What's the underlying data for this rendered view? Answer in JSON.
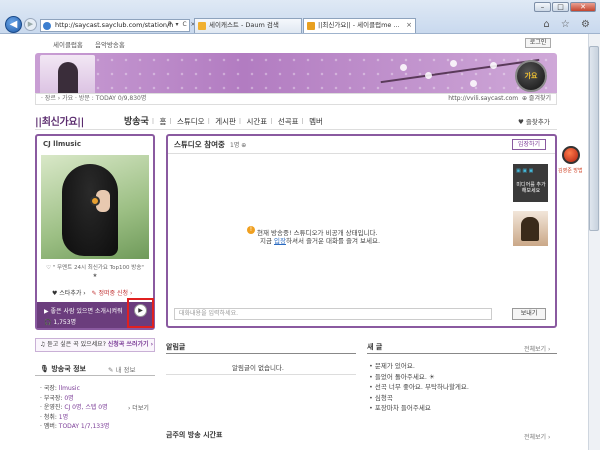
{
  "browser": {
    "address": "http://saycast.sayclub.com/station/h",
    "address_tools": "P ▾ C ×",
    "tabs": [
      {
        "label": "세이캐스트 - Daum 검색"
      },
      {
        "label": "||최신가요|| - 세이클럽me ..."
      }
    ],
    "win_min": "–",
    "win_max": "□",
    "win_close": "✕",
    "back": "◀",
    "forward": "▶",
    "ie_tools": "⌂ ☆ ⚙"
  },
  "site": {
    "top_links": [
      "세이클럽홈",
      "음악방송홈"
    ],
    "login": "로그인",
    "banner_badge": "가요",
    "info_left": "· 장르 › 가요 · 방문 : TODAY 0/9,830명",
    "info_url": "http://vvili.saycast.com",
    "info_fav": "⊕ 즐겨찾기",
    "channel_title": "||최신가요||",
    "nav": [
      "방송국",
      "홈",
      "스튜디오",
      "게시판",
      "시간표",
      "선곡표",
      "멤버"
    ],
    "fav_add": "♥ 즐찾추가"
  },
  "profile": {
    "dj_name": "CJ llmusic",
    "quote": "♡ \" 무멘트 24시 최신가요 Top100 방송\" ★",
    "star_add": "♥ 스타추가 ›",
    "report": "✎ 정떠중 신청 ›",
    "now_playing": "▶ 좋은 사람 있으면 소개시켜줘",
    "listeners": "🎧 1,753명",
    "play_icon": "▶"
  },
  "request": {
    "text": "♫ 듣고 싶은 곡 있으세요? ",
    "link": "신청곡 쓰러가기 ›"
  },
  "station_info": {
    "tab_station": "🎙 방송국 정보",
    "tab_myinfo": "✎ 내 정보",
    "rows": [
      {
        "label": "· 국장: ",
        "value": "llmusic"
      },
      {
        "label": "· 부국장: ",
        "value": "0명"
      },
      {
        "label": "· 운영진: ",
        "value": "CJ 0명, 스텝 0명"
      },
      {
        "label": "· 청취: ",
        "value": "1명"
      },
      {
        "label": "· 멤버: ",
        "value": "TODAY 1/7,133명"
      }
    ],
    "more": "› 더보기"
  },
  "studio": {
    "title": "스튜디오 참여중",
    "count": "1명 ⊕",
    "join": "입장하기",
    "msg_icon": "!",
    "msg1": "현재 방송중! 스튜디오가 비공개 상태입니다.",
    "msg2_pre": "지금 ",
    "msg2_link": "입장",
    "msg2_post": "하셔서 즐거운 대화를 즐겨 보세요.",
    "ad1_icons": "▣ ▣ ▣",
    "ad1_text": "미디어를 추가해보세요",
    "chat_placeholder": "대화내용을 입력하세요.",
    "send": "보내기"
  },
  "notice": {
    "title": "알림글",
    "empty": "알림글이 없습니다."
  },
  "board": {
    "title": "새 글",
    "more": "전체보기 ›",
    "items": [
      "문제가 있어요.",
      "들었어 돌아주세요. ☀",
      "선곡 너무 좋아요. 부탁하나할게요.",
      "심청곡",
      "포장마차 들어주세요"
    ]
  },
  "recent": {
    "title": "금주의 방송 시간표",
    "more": "전체보기 ›"
  },
  "side_widget": {
    "label": "김영준 방법"
  }
}
